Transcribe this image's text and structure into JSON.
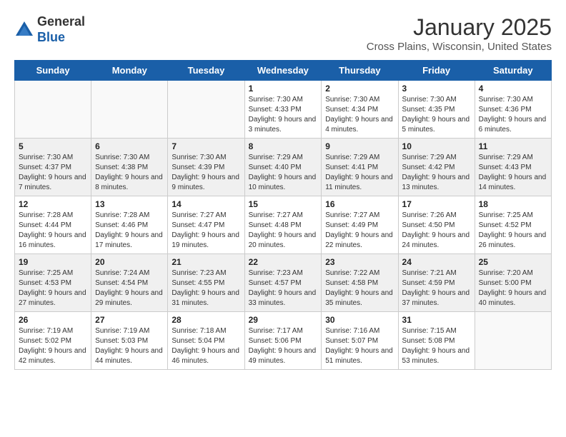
{
  "header": {
    "logo_line1": "General",
    "logo_line2": "Blue",
    "month": "January 2025",
    "location": "Cross Plains, Wisconsin, United States"
  },
  "weekdays": [
    "Sunday",
    "Monday",
    "Tuesday",
    "Wednesday",
    "Thursday",
    "Friday",
    "Saturday"
  ],
  "weeks": [
    [
      {
        "day": "",
        "sunrise": "",
        "sunset": "",
        "daylight": ""
      },
      {
        "day": "",
        "sunrise": "",
        "sunset": "",
        "daylight": ""
      },
      {
        "day": "",
        "sunrise": "",
        "sunset": "",
        "daylight": ""
      },
      {
        "day": "1",
        "sunrise": "Sunrise: 7:30 AM",
        "sunset": "Sunset: 4:33 PM",
        "daylight": "Daylight: 9 hours and 3 minutes."
      },
      {
        "day": "2",
        "sunrise": "Sunrise: 7:30 AM",
        "sunset": "Sunset: 4:34 PM",
        "daylight": "Daylight: 9 hours and 4 minutes."
      },
      {
        "day": "3",
        "sunrise": "Sunrise: 7:30 AM",
        "sunset": "Sunset: 4:35 PM",
        "daylight": "Daylight: 9 hours and 5 minutes."
      },
      {
        "day": "4",
        "sunrise": "Sunrise: 7:30 AM",
        "sunset": "Sunset: 4:36 PM",
        "daylight": "Daylight: 9 hours and 6 minutes."
      }
    ],
    [
      {
        "day": "5",
        "sunrise": "Sunrise: 7:30 AM",
        "sunset": "Sunset: 4:37 PM",
        "daylight": "Daylight: 9 hours and 7 minutes."
      },
      {
        "day": "6",
        "sunrise": "Sunrise: 7:30 AM",
        "sunset": "Sunset: 4:38 PM",
        "daylight": "Daylight: 9 hours and 8 minutes."
      },
      {
        "day": "7",
        "sunrise": "Sunrise: 7:30 AM",
        "sunset": "Sunset: 4:39 PM",
        "daylight": "Daylight: 9 hours and 9 minutes."
      },
      {
        "day": "8",
        "sunrise": "Sunrise: 7:29 AM",
        "sunset": "Sunset: 4:40 PM",
        "daylight": "Daylight: 9 hours and 10 minutes."
      },
      {
        "day": "9",
        "sunrise": "Sunrise: 7:29 AM",
        "sunset": "Sunset: 4:41 PM",
        "daylight": "Daylight: 9 hours and 11 minutes."
      },
      {
        "day": "10",
        "sunrise": "Sunrise: 7:29 AM",
        "sunset": "Sunset: 4:42 PM",
        "daylight": "Daylight: 9 hours and 13 minutes."
      },
      {
        "day": "11",
        "sunrise": "Sunrise: 7:29 AM",
        "sunset": "Sunset: 4:43 PM",
        "daylight": "Daylight: 9 hours and 14 minutes."
      }
    ],
    [
      {
        "day": "12",
        "sunrise": "Sunrise: 7:28 AM",
        "sunset": "Sunset: 4:44 PM",
        "daylight": "Daylight: 9 hours and 16 minutes."
      },
      {
        "day": "13",
        "sunrise": "Sunrise: 7:28 AM",
        "sunset": "Sunset: 4:46 PM",
        "daylight": "Daylight: 9 hours and 17 minutes."
      },
      {
        "day": "14",
        "sunrise": "Sunrise: 7:27 AM",
        "sunset": "Sunset: 4:47 PM",
        "daylight": "Daylight: 9 hours and 19 minutes."
      },
      {
        "day": "15",
        "sunrise": "Sunrise: 7:27 AM",
        "sunset": "Sunset: 4:48 PM",
        "daylight": "Daylight: 9 hours and 20 minutes."
      },
      {
        "day": "16",
        "sunrise": "Sunrise: 7:27 AM",
        "sunset": "Sunset: 4:49 PM",
        "daylight": "Daylight: 9 hours and 22 minutes."
      },
      {
        "day": "17",
        "sunrise": "Sunrise: 7:26 AM",
        "sunset": "Sunset: 4:50 PM",
        "daylight": "Daylight: 9 hours and 24 minutes."
      },
      {
        "day": "18",
        "sunrise": "Sunrise: 7:25 AM",
        "sunset": "Sunset: 4:52 PM",
        "daylight": "Daylight: 9 hours and 26 minutes."
      }
    ],
    [
      {
        "day": "19",
        "sunrise": "Sunrise: 7:25 AM",
        "sunset": "Sunset: 4:53 PM",
        "daylight": "Daylight: 9 hours and 27 minutes."
      },
      {
        "day": "20",
        "sunrise": "Sunrise: 7:24 AM",
        "sunset": "Sunset: 4:54 PM",
        "daylight": "Daylight: 9 hours and 29 minutes."
      },
      {
        "day": "21",
        "sunrise": "Sunrise: 7:23 AM",
        "sunset": "Sunset: 4:55 PM",
        "daylight": "Daylight: 9 hours and 31 minutes."
      },
      {
        "day": "22",
        "sunrise": "Sunrise: 7:23 AM",
        "sunset": "Sunset: 4:57 PM",
        "daylight": "Daylight: 9 hours and 33 minutes."
      },
      {
        "day": "23",
        "sunrise": "Sunrise: 7:22 AM",
        "sunset": "Sunset: 4:58 PM",
        "daylight": "Daylight: 9 hours and 35 minutes."
      },
      {
        "day": "24",
        "sunrise": "Sunrise: 7:21 AM",
        "sunset": "Sunset: 4:59 PM",
        "daylight": "Daylight: 9 hours and 37 minutes."
      },
      {
        "day": "25",
        "sunrise": "Sunrise: 7:20 AM",
        "sunset": "Sunset: 5:00 PM",
        "daylight": "Daylight: 9 hours and 40 minutes."
      }
    ],
    [
      {
        "day": "26",
        "sunrise": "Sunrise: 7:19 AM",
        "sunset": "Sunset: 5:02 PM",
        "daylight": "Daylight: 9 hours and 42 minutes."
      },
      {
        "day": "27",
        "sunrise": "Sunrise: 7:19 AM",
        "sunset": "Sunset: 5:03 PM",
        "daylight": "Daylight: 9 hours and 44 minutes."
      },
      {
        "day": "28",
        "sunrise": "Sunrise: 7:18 AM",
        "sunset": "Sunset: 5:04 PM",
        "daylight": "Daylight: 9 hours and 46 minutes."
      },
      {
        "day": "29",
        "sunrise": "Sunrise: 7:17 AM",
        "sunset": "Sunset: 5:06 PM",
        "daylight": "Daylight: 9 hours and 49 minutes."
      },
      {
        "day": "30",
        "sunrise": "Sunrise: 7:16 AM",
        "sunset": "Sunset: 5:07 PM",
        "daylight": "Daylight: 9 hours and 51 minutes."
      },
      {
        "day": "31",
        "sunrise": "Sunrise: 7:15 AM",
        "sunset": "Sunset: 5:08 PM",
        "daylight": "Daylight: 9 hours and 53 minutes."
      },
      {
        "day": "",
        "sunrise": "",
        "sunset": "",
        "daylight": ""
      }
    ]
  ]
}
